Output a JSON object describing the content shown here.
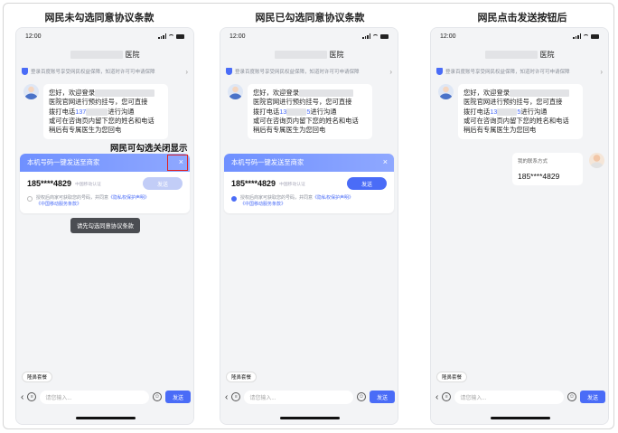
{
  "panels": [
    {
      "title": "网民未勾选同意协议条款"
    },
    {
      "title": "网民已勾选同意协议条款"
    },
    {
      "title": "网民点击发送按钮后"
    }
  ],
  "status": {
    "time": "12:00"
  },
  "header": {
    "name_suffix": "医院"
  },
  "notice": {
    "text": "登录百度账号享受网民权益保障，知道时许可可申请保障"
  },
  "chat": {
    "greeting_line1_prefix": "您好，欢迎登录",
    "line2": "医院官网进行预约挂号，您可直接",
    "line3_prefix": "拨打电话",
    "phone_p1a": "137",
    "phone_p2a": "13",
    "phone_p2b": "5",
    "line3_suffix": "进行沟通",
    "line4": "或可在咨询页内留下您的姓名和电话",
    "line5": "稍后有专属医生为您回电"
  },
  "card": {
    "title": "本机号码一键发送至商家",
    "close": "×",
    "phone": "185****4829",
    "carrier": "中国移动认证",
    "send": "发送",
    "agree_text": "授权后商家可获取您的号码，并同意",
    "privacy_link": "《隐私权保护声明》",
    "service_link": "《中国移动服务条款》"
  },
  "toast": "请先勾选同意协议条款",
  "annotation": "网民可勾选关闭显示",
  "contact": {
    "label": "我的联系方式",
    "phone": "185****4829"
  },
  "bottom": {
    "tag": "隆鼻套餐",
    "placeholder": "请您输入...",
    "send": "发送"
  }
}
